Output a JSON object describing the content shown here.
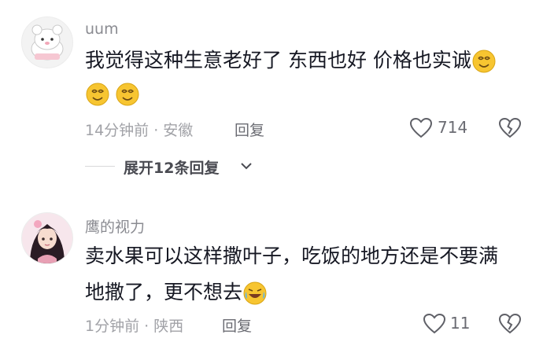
{
  "comments": [
    {
      "username": "uum",
      "text_line1": "我觉得这种生意老好了 东西也好 价格也实诚",
      "time_location": "14分钟前 · 安徽",
      "reply_label": "回复",
      "like_count": "714",
      "expand_replies": "展开12条回复"
    },
    {
      "username": "鹰的视力",
      "text_line1": "卖水果可以这样撒叶子，吃饭的地方还是不要满",
      "text_line2": "地撒了，更不想去",
      "time_location": "1分钟前 · 陕西",
      "reply_label": "回复",
      "like_count": "11"
    }
  ],
  "icons": {
    "like": "heart-outline-icon",
    "dislike": "broken-heart-icon",
    "expand": "chevron-down-icon",
    "emoji1": "dizzy-smile-emoji",
    "emoji2": "laugh-cry-emoji"
  },
  "colors": {
    "text": "#161823",
    "muted": "#a1a2a7",
    "emoji_yellow": "#f7c531"
  }
}
